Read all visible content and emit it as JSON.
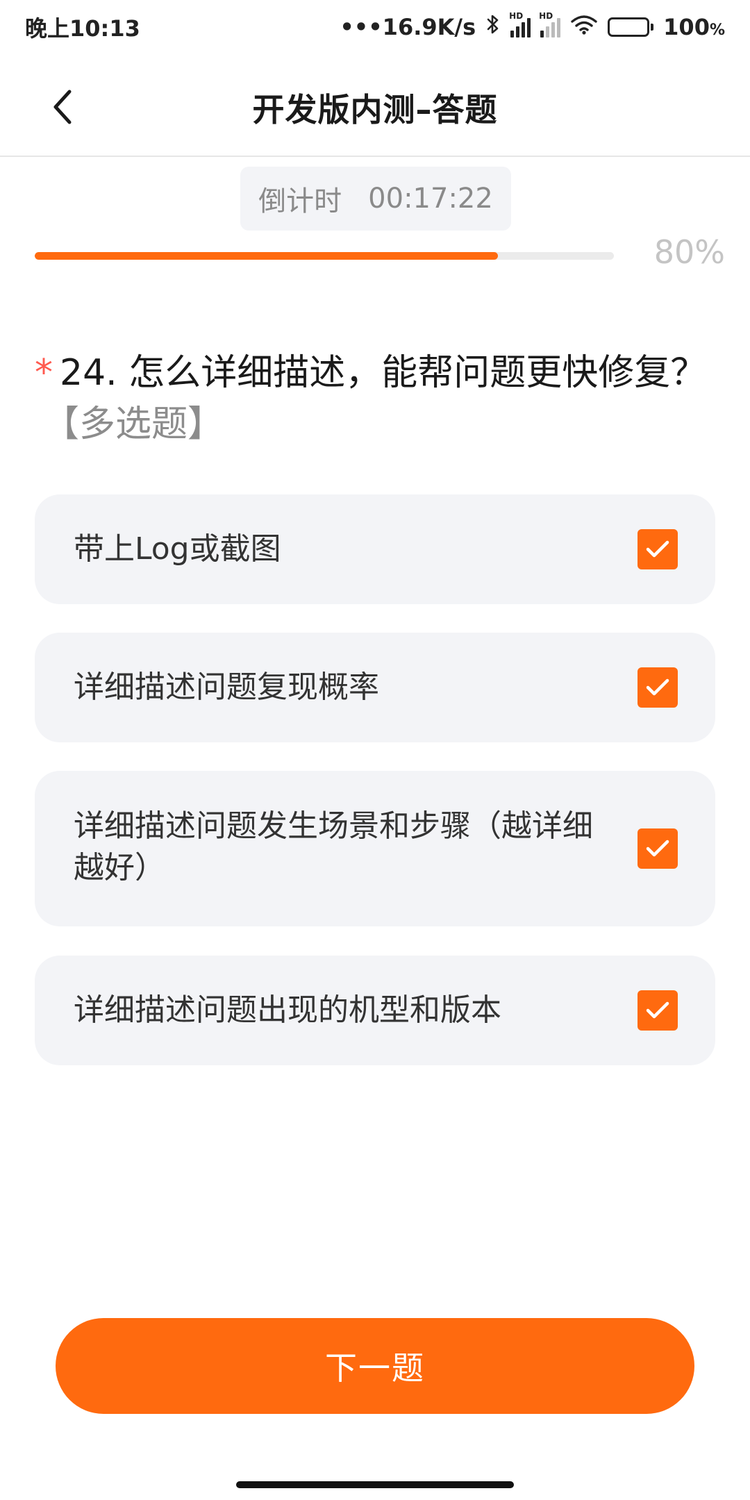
{
  "status_bar": {
    "time": "晚上10:13",
    "network_speed": "•••16.9K/s",
    "hd1": "HD",
    "hd2": "HD",
    "battery_percent": "100",
    "percent_sign": "%",
    "battery_color": "#37c236"
  },
  "header": {
    "back_icon": "chevron-left-icon",
    "title": "开发版内测–答题"
  },
  "countdown": {
    "label": "倒计时",
    "value": "00:17:22"
  },
  "progress": {
    "percent": 80,
    "label": "80%",
    "fill_color": "#ff6a0f"
  },
  "question": {
    "required_mark": "*",
    "text": "24. 怎么详细描述，能帮问题更快修复？",
    "type_label": "【多选题】"
  },
  "options": [
    {
      "label": "带上Log或截图",
      "checked": true
    },
    {
      "label": "详细描述问题复现概率",
      "checked": true
    },
    {
      "label": "详细描述问题发生场景和步骤（越详细越好）",
      "checked": true
    },
    {
      "label": "详细描述问题出现的机型和版本",
      "checked": true
    }
  ],
  "next_button": {
    "label": "下一题"
  },
  "colors": {
    "accent": "#ff6a0f",
    "option_bg": "#f3f4f7",
    "required": "#ff5a4f"
  }
}
